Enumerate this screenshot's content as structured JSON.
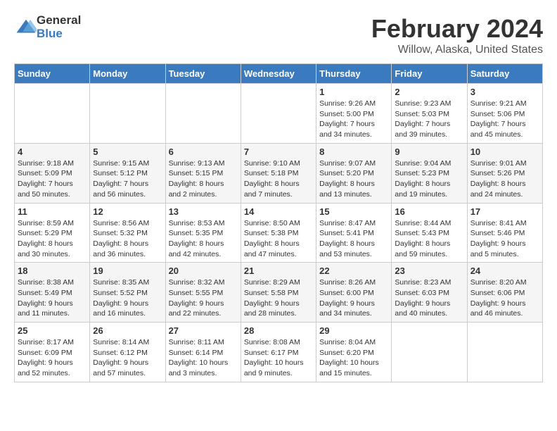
{
  "header": {
    "logo_general": "General",
    "logo_blue": "Blue",
    "month_year": "February 2024",
    "location": "Willow, Alaska, United States"
  },
  "days_of_week": [
    "Sunday",
    "Monday",
    "Tuesday",
    "Wednesday",
    "Thursday",
    "Friday",
    "Saturday"
  ],
  "weeks": [
    [
      {
        "day": "",
        "sunrise": "",
        "sunset": "",
        "daylight": ""
      },
      {
        "day": "",
        "sunrise": "",
        "sunset": "",
        "daylight": ""
      },
      {
        "day": "",
        "sunrise": "",
        "sunset": "",
        "daylight": ""
      },
      {
        "day": "",
        "sunrise": "",
        "sunset": "",
        "daylight": ""
      },
      {
        "day": "1",
        "sunrise": "Sunrise: 9:26 AM",
        "sunset": "Sunset: 5:00 PM",
        "daylight": "Daylight: 7 hours and 34 minutes."
      },
      {
        "day": "2",
        "sunrise": "Sunrise: 9:23 AM",
        "sunset": "Sunset: 5:03 PM",
        "daylight": "Daylight: 7 hours and 39 minutes."
      },
      {
        "day": "3",
        "sunrise": "Sunrise: 9:21 AM",
        "sunset": "Sunset: 5:06 PM",
        "daylight": "Daylight: 7 hours and 45 minutes."
      }
    ],
    [
      {
        "day": "4",
        "sunrise": "Sunrise: 9:18 AM",
        "sunset": "Sunset: 5:09 PM",
        "daylight": "Daylight: 7 hours and 50 minutes."
      },
      {
        "day": "5",
        "sunrise": "Sunrise: 9:15 AM",
        "sunset": "Sunset: 5:12 PM",
        "daylight": "Daylight: 7 hours and 56 minutes."
      },
      {
        "day": "6",
        "sunrise": "Sunrise: 9:13 AM",
        "sunset": "Sunset: 5:15 PM",
        "daylight": "Daylight: 8 hours and 2 minutes."
      },
      {
        "day": "7",
        "sunrise": "Sunrise: 9:10 AM",
        "sunset": "Sunset: 5:18 PM",
        "daylight": "Daylight: 8 hours and 7 minutes."
      },
      {
        "day": "8",
        "sunrise": "Sunrise: 9:07 AM",
        "sunset": "Sunset: 5:20 PM",
        "daylight": "Daylight: 8 hours and 13 minutes."
      },
      {
        "day": "9",
        "sunrise": "Sunrise: 9:04 AM",
        "sunset": "Sunset: 5:23 PM",
        "daylight": "Daylight: 8 hours and 19 minutes."
      },
      {
        "day": "10",
        "sunrise": "Sunrise: 9:01 AM",
        "sunset": "Sunset: 5:26 PM",
        "daylight": "Daylight: 8 hours and 24 minutes."
      }
    ],
    [
      {
        "day": "11",
        "sunrise": "Sunrise: 8:59 AM",
        "sunset": "Sunset: 5:29 PM",
        "daylight": "Daylight: 8 hours and 30 minutes."
      },
      {
        "day": "12",
        "sunrise": "Sunrise: 8:56 AM",
        "sunset": "Sunset: 5:32 PM",
        "daylight": "Daylight: 8 hours and 36 minutes."
      },
      {
        "day": "13",
        "sunrise": "Sunrise: 8:53 AM",
        "sunset": "Sunset: 5:35 PM",
        "daylight": "Daylight: 8 hours and 42 minutes."
      },
      {
        "day": "14",
        "sunrise": "Sunrise: 8:50 AM",
        "sunset": "Sunset: 5:38 PM",
        "daylight": "Daylight: 8 hours and 47 minutes."
      },
      {
        "day": "15",
        "sunrise": "Sunrise: 8:47 AM",
        "sunset": "Sunset: 5:41 PM",
        "daylight": "Daylight: 8 hours and 53 minutes."
      },
      {
        "day": "16",
        "sunrise": "Sunrise: 8:44 AM",
        "sunset": "Sunset: 5:43 PM",
        "daylight": "Daylight: 8 hours and 59 minutes."
      },
      {
        "day": "17",
        "sunrise": "Sunrise: 8:41 AM",
        "sunset": "Sunset: 5:46 PM",
        "daylight": "Daylight: 9 hours and 5 minutes."
      }
    ],
    [
      {
        "day": "18",
        "sunrise": "Sunrise: 8:38 AM",
        "sunset": "Sunset: 5:49 PM",
        "daylight": "Daylight: 9 hours and 11 minutes."
      },
      {
        "day": "19",
        "sunrise": "Sunrise: 8:35 AM",
        "sunset": "Sunset: 5:52 PM",
        "daylight": "Daylight: 9 hours and 16 minutes."
      },
      {
        "day": "20",
        "sunrise": "Sunrise: 8:32 AM",
        "sunset": "Sunset: 5:55 PM",
        "daylight": "Daylight: 9 hours and 22 minutes."
      },
      {
        "day": "21",
        "sunrise": "Sunrise: 8:29 AM",
        "sunset": "Sunset: 5:58 PM",
        "daylight": "Daylight: 9 hours and 28 minutes."
      },
      {
        "day": "22",
        "sunrise": "Sunrise: 8:26 AM",
        "sunset": "Sunset: 6:00 PM",
        "daylight": "Daylight: 9 hours and 34 minutes."
      },
      {
        "day": "23",
        "sunrise": "Sunrise: 8:23 AM",
        "sunset": "Sunset: 6:03 PM",
        "daylight": "Daylight: 9 hours and 40 minutes."
      },
      {
        "day": "24",
        "sunrise": "Sunrise: 8:20 AM",
        "sunset": "Sunset: 6:06 PM",
        "daylight": "Daylight: 9 hours and 46 minutes."
      }
    ],
    [
      {
        "day": "25",
        "sunrise": "Sunrise: 8:17 AM",
        "sunset": "Sunset: 6:09 PM",
        "daylight": "Daylight: 9 hours and 52 minutes."
      },
      {
        "day": "26",
        "sunrise": "Sunrise: 8:14 AM",
        "sunset": "Sunset: 6:12 PM",
        "daylight": "Daylight: 9 hours and 57 minutes."
      },
      {
        "day": "27",
        "sunrise": "Sunrise: 8:11 AM",
        "sunset": "Sunset: 6:14 PM",
        "daylight": "Daylight: 10 hours and 3 minutes."
      },
      {
        "day": "28",
        "sunrise": "Sunrise: 8:08 AM",
        "sunset": "Sunset: 6:17 PM",
        "daylight": "Daylight: 10 hours and 9 minutes."
      },
      {
        "day": "29",
        "sunrise": "Sunrise: 8:04 AM",
        "sunset": "Sunset: 6:20 PM",
        "daylight": "Daylight: 10 hours and 15 minutes."
      },
      {
        "day": "",
        "sunrise": "",
        "sunset": "",
        "daylight": ""
      },
      {
        "day": "",
        "sunrise": "",
        "sunset": "",
        "daylight": ""
      }
    ]
  ]
}
